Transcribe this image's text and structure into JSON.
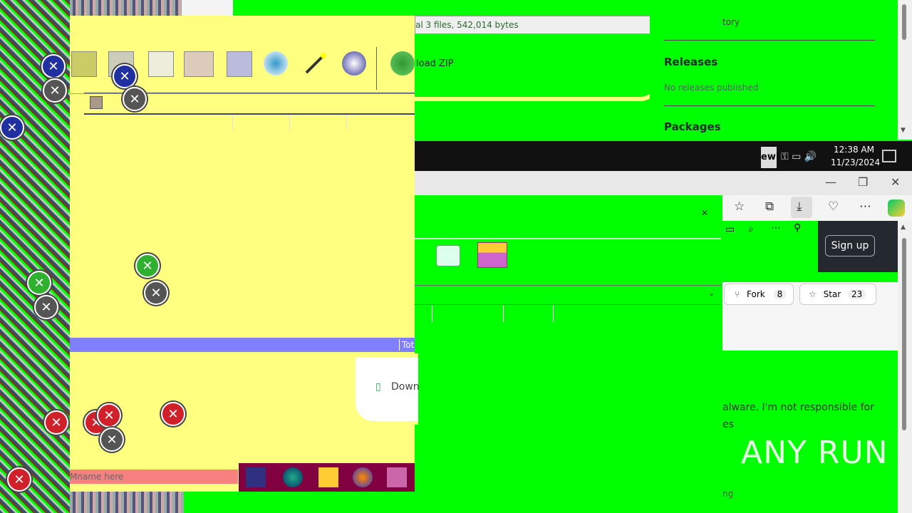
{
  "zip_window": {
    "status_total": "Tot",
    "filename_placeholder": "Mname here"
  },
  "topbar": {
    "summary": "al 3 files, 542,014 bytes",
    "download_zip": "load ZIP"
  },
  "gh_sidebar": {
    "history": "tory",
    "releases_title": "Releases",
    "releases_text": "No releases published",
    "packages_title": "Packages"
  },
  "taskbar": {
    "time": "12:38 AM",
    "date": "11/23/2024",
    "app_label": "ewi"
  },
  "browser": {
    "sign_up": "Sign up",
    "fork_label": "Fork",
    "fork_count": "8",
    "star_label": "Star",
    "star_count": "23"
  },
  "readme": {
    "line1": "alware. I'm not responsible for",
    "line2": "es",
    "line3": "ng"
  },
  "download_box": {
    "label": "Down"
  },
  "watermark": {
    "text": "ANY RUN"
  }
}
